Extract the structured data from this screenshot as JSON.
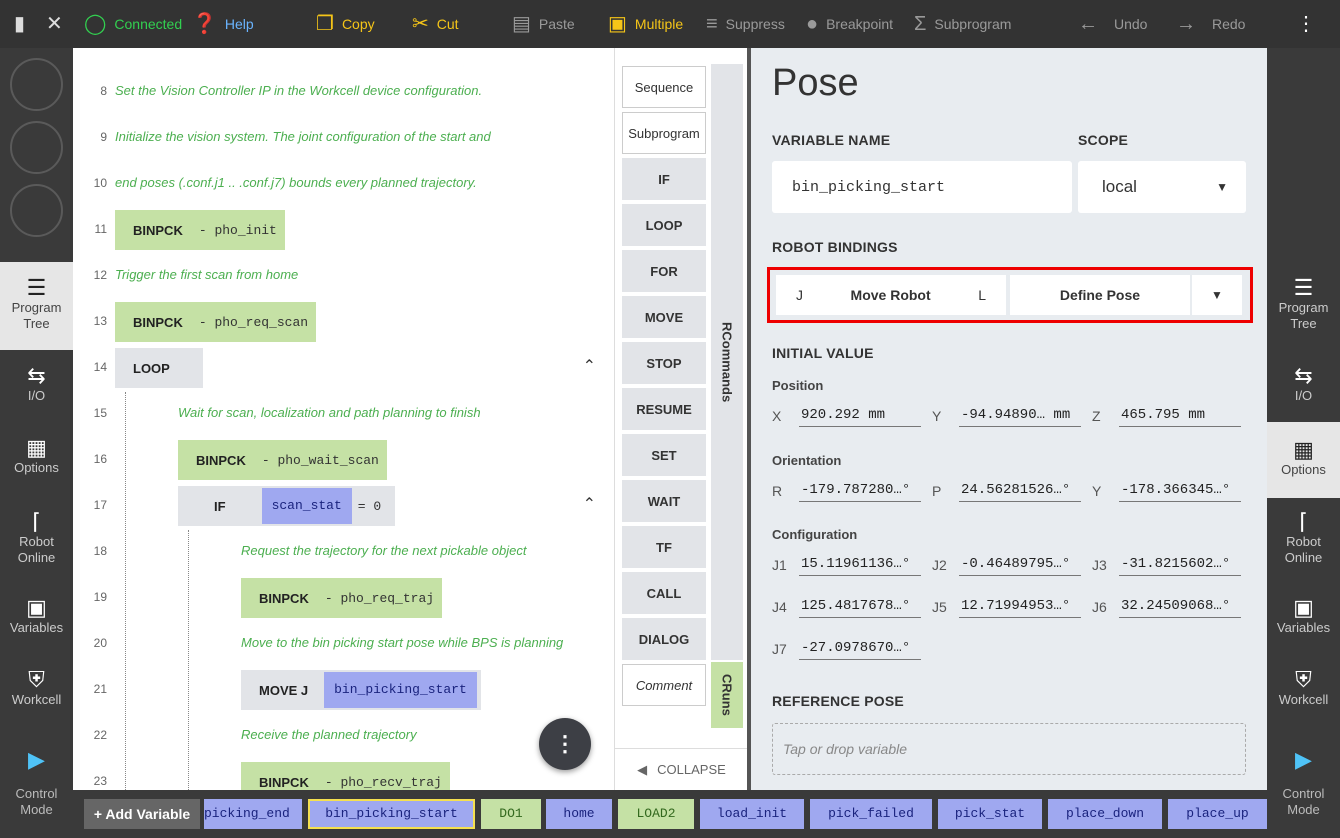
{
  "topbar": {
    "connected": "Connected",
    "help": "Help",
    "copy": "Copy",
    "cut": "Cut",
    "paste": "Paste",
    "multiple": "Multiple",
    "suppress": "Suppress",
    "breakpoint": "Breakpoint",
    "subprogram": "Subprogram",
    "undo": "Undo",
    "redo": "Redo"
  },
  "leftrail": {
    "items": [
      {
        "label": "Program Tree",
        "icon": "list-icon"
      },
      {
        "label": "I/O",
        "icon": "io-arrows-icon"
      },
      {
        "label": "Options",
        "icon": "clipboard-icon"
      },
      {
        "label": "Robot Online",
        "icon": "robot-arm-icon"
      },
      {
        "label": "Variables",
        "icon": "briefcase-icon"
      },
      {
        "label": "Workcell",
        "icon": "shield-icon"
      }
    ],
    "control": "Control Mode"
  },
  "tree": {
    "r8": {
      "ln": "8",
      "text": "Set the Vision Controller IP in the Workcell device configuration."
    },
    "r9": {
      "ln": "9",
      "text": "Initialize the vision system. The joint configuration of the start and"
    },
    "r10": {
      "ln": "10",
      "text": "end poses (.conf.j1 .. .conf.j7) bounds every planned trajectory."
    },
    "r11": {
      "ln": "11",
      "kw": "BINPCK",
      "arg": "- pho_init"
    },
    "r12": {
      "ln": "12",
      "text": "Trigger the first scan from home"
    },
    "r13": {
      "ln": "13",
      "kw": "BINPCK",
      "arg": "- pho_req_scan"
    },
    "r14": {
      "ln": "14",
      "kw": "LOOP"
    },
    "r15": {
      "ln": "15",
      "text": "Wait for scan, localization and path planning to finish"
    },
    "r16": {
      "ln": "16",
      "kw": "BINPCK",
      "arg": "- pho_wait_scan"
    },
    "r17": {
      "ln": "17",
      "kw": "IF",
      "var": "scan_stat",
      "rest": "= 0"
    },
    "r18": {
      "ln": "18",
      "text": "Request the trajectory for the next pickable object"
    },
    "r19": {
      "ln": "19",
      "kw": "BINPCK",
      "arg": "- pho_req_traj"
    },
    "r20": {
      "ln": "20",
      "text": "Move to the bin picking start pose while BPS is planning"
    },
    "r21": {
      "ln": "21",
      "kw": "MOVE J",
      "var": "bin_picking_start"
    },
    "r22": {
      "ln": "22",
      "text": "Receive the planned trajectory"
    },
    "r23": {
      "ln": "23",
      "kw": "BINPCK",
      "arg": "- pho_recv_traj"
    }
  },
  "commands": {
    "buttons": [
      "Sequence",
      "Subprogram",
      "IF",
      "LOOP",
      "FOR",
      "MOVE",
      "STOP",
      "RESUME",
      "SET",
      "WAIT",
      "TF",
      "CALL",
      "DIALOG",
      "Comment"
    ],
    "tab_rcommands": "RCommands",
    "tab_cruns": "CRuns",
    "collapse": "COLLAPSE"
  },
  "props": {
    "title": "Pose",
    "var_name_label": "VARIABLE NAME",
    "scope_label": "SCOPE",
    "var_name": "bin_picking_start",
    "scope": "local",
    "bindings_label": "ROBOT BINDINGS",
    "bind_j": "J",
    "bind_move": "Move Robot",
    "bind_l": "L",
    "bind_define": "Define Pose",
    "initial_label": "INITIAL VALUE",
    "position_label": "Position",
    "x": "920.292 mm",
    "y": "-94.94890… mm",
    "z": "465.795 mm",
    "orientation_label": "Orientation",
    "r": "-179.787280…°",
    "p": "24.56281526…°",
    "yaw": "-178.366345…°",
    "config_label": "Configuration",
    "j1": "15.11961136…°",
    "j2": "-0.46489795…°",
    "j3": "-31.8215602…°",
    "j4": "125.4817678…°",
    "j5": "12.71994953…°",
    "j6": "32.24509068…°",
    "j7": "-27.0978670…°",
    "ref_label": "REFERENCE POSE",
    "ref_placeholder": "Tap or drop variable"
  },
  "bottombar": {
    "add": "+ Add Variable",
    "chips": [
      "picking_end",
      "bin_picking_start",
      "DO1",
      "home",
      "LOAD2",
      "load_init",
      "pick_failed",
      "pick_stat",
      "place_down",
      "place_up"
    ]
  }
}
